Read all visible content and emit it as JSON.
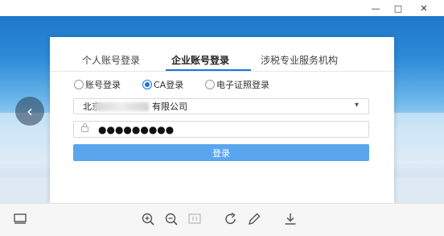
{
  "window": {
    "minimize_glyph": "—",
    "maximize_glyph": "□",
    "close_glyph": "✕"
  },
  "nav": {
    "prev_glyph": "‹"
  },
  "login": {
    "tabs": [
      {
        "label": "个人账号登录",
        "active": false
      },
      {
        "label": "企业账号登录",
        "active": true
      },
      {
        "label": "涉税专业服务机构",
        "active": false
      }
    ],
    "methods": [
      {
        "label": "账号登录",
        "checked": false
      },
      {
        "label": "CA登录",
        "checked": true
      },
      {
        "label": "电子证照登录",
        "checked": false
      }
    ],
    "company_prefix": "北京",
    "company_suffix": "有限公司",
    "password_mask": "●●●●●●●●●",
    "submit_label": "登录"
  },
  "colors": {
    "accent": "#1a73e8",
    "button": "#5aa6ee"
  },
  "toolbar_icons": [
    "screen-icon",
    "zoom-in-icon",
    "zoom-out-icon",
    "fit-icon",
    "rotate-icon",
    "edit-icon",
    "download-icon"
  ]
}
